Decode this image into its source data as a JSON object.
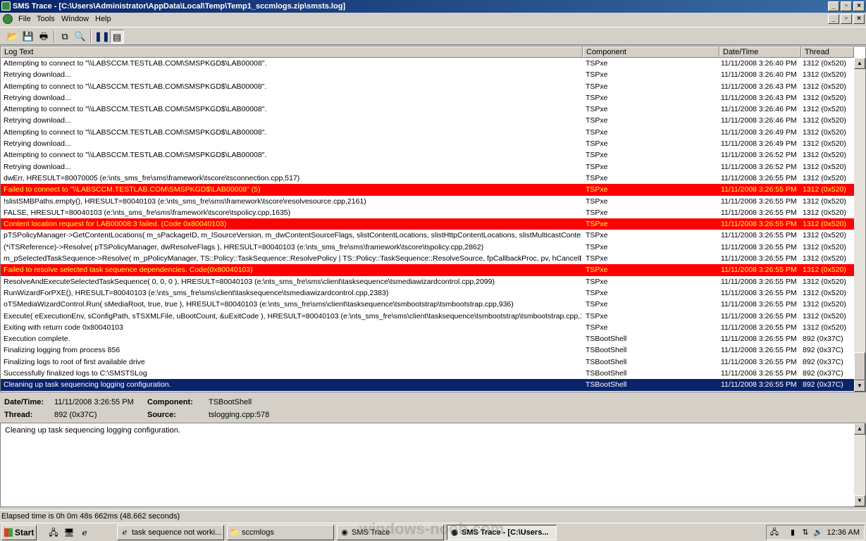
{
  "window": {
    "title": "SMS Trace - [C:\\Users\\Administrator\\AppData\\Local\\Temp\\Temp1_sccmlogs.zip\\smsts.log]"
  },
  "menu": [
    "File",
    "Tools",
    "Window",
    "Help"
  ],
  "columns": {
    "log_text": "Log Text",
    "component": "Component",
    "datetime": "Date/Time",
    "thread": "Thread"
  },
  "rows": [
    {
      "text": "Attempting to connect to \"\\\\LABSCCM.TESTLAB.COM\\SMSPKGD$\\LAB00008\".",
      "comp": "TSPxe",
      "dt": "11/11/2008 3:26:40 PM",
      "th": "1312 (0x520)",
      "kind": "normal"
    },
    {
      "text": "Retrying download...",
      "comp": "TSPxe",
      "dt": "11/11/2008 3:26:40 PM",
      "th": "1312 (0x520)",
      "kind": "normal"
    },
    {
      "text": "Attempting to connect to \"\\\\LABSCCM.TESTLAB.COM\\SMSPKGD$\\LAB00008\".",
      "comp": "TSPxe",
      "dt": "11/11/2008 3:26:43 PM",
      "th": "1312 (0x520)",
      "kind": "normal"
    },
    {
      "text": "Retrying download...",
      "comp": "TSPxe",
      "dt": "11/11/2008 3:26:43 PM",
      "th": "1312 (0x520)",
      "kind": "normal"
    },
    {
      "text": "Attempting to connect to \"\\\\LABSCCM.TESTLAB.COM\\SMSPKGD$\\LAB00008\".",
      "comp": "TSPxe",
      "dt": "11/11/2008 3:26:46 PM",
      "th": "1312 (0x520)",
      "kind": "normal"
    },
    {
      "text": "Retrying download...",
      "comp": "TSPxe",
      "dt": "11/11/2008 3:26:46 PM",
      "th": "1312 (0x520)",
      "kind": "normal"
    },
    {
      "text": "Attempting to connect to \"\\\\LABSCCM.TESTLAB.COM\\SMSPKGD$\\LAB00008\".",
      "comp": "TSPxe",
      "dt": "11/11/2008 3:26:49 PM",
      "th": "1312 (0x520)",
      "kind": "normal"
    },
    {
      "text": "Retrying download...",
      "comp": "TSPxe",
      "dt": "11/11/2008 3:26:49 PM",
      "th": "1312 (0x520)",
      "kind": "normal"
    },
    {
      "text": "Attempting to connect to \"\\\\LABSCCM.TESTLAB.COM\\SMSPKGD$\\LAB00008\".",
      "comp": "TSPxe",
      "dt": "11/11/2008 3:26:52 PM",
      "th": "1312 (0x520)",
      "kind": "normal"
    },
    {
      "text": "Retrying download...",
      "comp": "TSPxe",
      "dt": "11/11/2008 3:26:52 PM",
      "th": "1312 (0x520)",
      "kind": "normal"
    },
    {
      "text": "dwErr, HRESULT=80070005 (e:\\nts_sms_fre\\sms\\framework\\tscore\\tsconnection.cpp,517)",
      "comp": "TSPxe",
      "dt": "11/11/2008 3:26:55 PM",
      "th": "1312 (0x520)",
      "kind": "normal"
    },
    {
      "text": "Failed to connect to \"\\\\LABSCCM.TESTLAB.COM\\SMSPKGD$\\LAB00008\" (5)",
      "comp": "TSPxe",
      "dt": "11/11/2008 3:26:55 PM",
      "th": "1312 (0x520)",
      "kind": "err"
    },
    {
      "text": "!slistSMBPaths.empty(), HRESULT=80040103 (e:\\nts_sms_fre\\sms\\framework\\tscore\\resolvesource.cpp,2161)",
      "comp": "TSPxe",
      "dt": "11/11/2008 3:26:55 PM",
      "th": "1312 (0x520)",
      "kind": "normal"
    },
    {
      "text": "FALSE, HRESULT=80040103 (e:\\nts_sms_fre\\sms\\framework\\tscore\\tspolicy.cpp,1635)",
      "comp": "TSPxe",
      "dt": "11/11/2008 3:26:55 PM",
      "th": "1312 (0x520)",
      "kind": "normal"
    },
    {
      "text": "Content location request for LAB00008:3 failed. (Code 0x80040103)",
      "comp": "TSPxe",
      "dt": "11/11/2008 3:26:55 PM",
      "th": "1312 (0x520)",
      "kind": "err"
    },
    {
      "text": "pTSPolicyManager->GetContentLocations( m_sPackageID, m_lSourceVersion, m_dwContentSourceFlags, slistContentLocations, slistHttpContentLocations, slistMulticastContentLoca",
      "comp": "TSPxe",
      "dt": "11/11/2008 3:26:55 PM",
      "th": "1312 (0x520)",
      "kind": "normal"
    },
    {
      "text": "(*iTSReference)->Resolve( pTSPolicyManager, dwResolveFlags ), HRESULT=80040103 (e:\\nts_sms_fre\\sms\\framework\\tscore\\tspolicy.cpp,2862)",
      "comp": "TSPxe",
      "dt": "11/11/2008 3:26:55 PM",
      "th": "1312 (0x520)",
      "kind": "normal"
    },
    {
      "text": "m_pSelectedTaskSequence->Resolve( m_pPolicyManager, TS::Policy::TaskSequence::ResolvePolicy | TS::Policy::TaskSequence::ResolveSource, fpCallbackProc, pv, hCancelEv",
      "comp": "TSPxe",
      "dt": "11/11/2008 3:26:55 PM",
      "th": "1312 (0x520)",
      "kind": "normal"
    },
    {
      "text": "Failed to resolve selected task sequence dependencies. Code(0x80040103)",
      "comp": "TSPxe",
      "dt": "11/11/2008 3:26:55 PM",
      "th": "1312 (0x520)",
      "kind": "err"
    },
    {
      "text": "ResolveAndExecuteSelectedTaskSequence( 0, 0, 0 ), HRESULT=80040103 (e:\\nts_sms_fre\\sms\\client\\tasksequence\\tsmediawizardcontrol.cpp,2099)",
      "comp": "TSPxe",
      "dt": "11/11/2008 3:26:55 PM",
      "th": "1312 (0x520)",
      "kind": "normal"
    },
    {
      "text": "RunWizardForPXE(), HRESULT=80040103 (e:\\nts_sms_fre\\sms\\client\\tasksequence\\tsmediawizardcontrol.cpp,2383)",
      "comp": "TSPxe",
      "dt": "11/11/2008 3:26:55 PM",
      "th": "1312 (0x520)",
      "kind": "normal"
    },
    {
      "text": "oTSMediaWizardControl.Run( sMediaRoot, true, true ), HRESULT=80040103 (e:\\nts_sms_fre\\sms\\client\\tasksequence\\tsmbootstrap\\tsmbootstrap.cpp,936)",
      "comp": "TSPxe",
      "dt": "11/11/2008 3:26:55 PM",
      "th": "1312 (0x520)",
      "kind": "normal"
    },
    {
      "text": "Execute( eExecutionEnv, sConfigPath, sTSXMLFile, uBootCount, &uExitCode ), HRESULT=80040103 (e:\\nts_sms_fre\\sms\\client\\tasksequence\\tsmbootstrap\\tsmbootstrap.cpp,110",
      "comp": "TSPxe",
      "dt": "11/11/2008 3:26:55 PM",
      "th": "1312 (0x520)",
      "kind": "normal"
    },
    {
      "text": "Exiting with return code 0x80040103",
      "comp": "TSPxe",
      "dt": "11/11/2008 3:26:55 PM",
      "th": "1312 (0x520)",
      "kind": "normal"
    },
    {
      "text": "Execution complete.",
      "comp": "TSBootShell",
      "dt": "11/11/2008 3:26:55 PM",
      "th": "892 (0x37C)",
      "kind": "normal"
    },
    {
      "text": "Finalizing logging from process 856",
      "comp": "TSBootShell",
      "dt": "11/11/2008 3:26:55 PM",
      "th": "892 (0x37C)",
      "kind": "normal"
    },
    {
      "text": "Finalizing logs to root of first available drive",
      "comp": "TSBootShell",
      "dt": "11/11/2008 3:26:55 PM",
      "th": "892 (0x37C)",
      "kind": "normal"
    },
    {
      "text": "Successfully finalized logs to C:\\SMSTSLog",
      "comp": "TSBootShell",
      "dt": "11/11/2008 3:26:55 PM",
      "th": "892 (0x37C)",
      "kind": "normal"
    },
    {
      "text": "Cleaning up task sequencing logging configuration.",
      "comp": "TSBootShell",
      "dt": "11/11/2008 3:26:55 PM",
      "th": "892 (0x37C)",
      "kind": "sel"
    }
  ],
  "details": {
    "datetime_label": "Date/Time:",
    "datetime_value": "11/11/2008 3:26:55 PM",
    "component_label": "Component:",
    "component_value": "TSBootShell",
    "thread_label": "Thread:",
    "thread_value": "892 (0x37C)",
    "source_label": "Source:",
    "source_value": "tslogging.cpp:578",
    "message": "Cleaning up task sequencing logging configuration."
  },
  "status": "Elapsed time is 0h 0m 48s 662ms (48.662 seconds)",
  "taskbar": {
    "start": "Start",
    "tasks": [
      "task sequence not worki...",
      "sccmlogs",
      "SMS Trace",
      "SMS Trace - [C:\\Users..."
    ],
    "clock": "12:36 AM",
    "watermark": "windows-noob.com"
  },
  "colors": {
    "error_row": "#ff0000",
    "error_text": "#ffff40",
    "selected_row": "#0a246a",
    "title_gradient": "#0a246a"
  }
}
